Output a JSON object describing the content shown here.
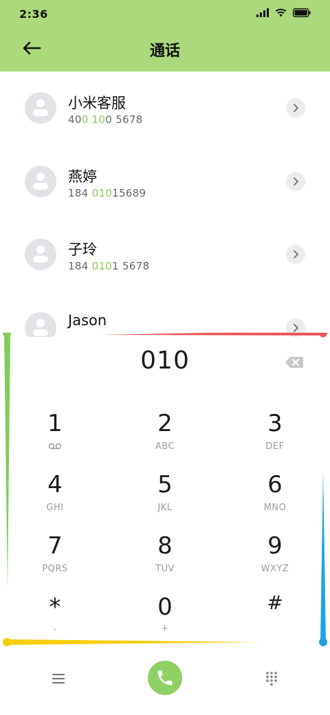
{
  "status_bar": {
    "time": "2:36",
    "icons": [
      "signal-icon",
      "wifi-icon",
      "battery-icon"
    ]
  },
  "header": {
    "title": "通话",
    "back_icon": "arrow-left-icon",
    "background_color": "#abd97c"
  },
  "contacts": [
    {
      "name": "小米客服",
      "number_parts": [
        {
          "text": "40",
          "match": false
        },
        {
          "text": "0",
          "match": true
        },
        {
          "text": " ",
          "match": false
        },
        {
          "text": "10",
          "match": true
        },
        {
          "text": "0 5678",
          "match": false
        }
      ]
    },
    {
      "name": "燕婷",
      "number_parts": [
        {
          "text": "184 ",
          "match": false
        },
        {
          "text": "010",
          "match": true
        },
        {
          "text": "15689",
          "match": false
        }
      ]
    },
    {
      "name": "子玲",
      "number_parts": [
        {
          "text": "184 ",
          "match": false
        },
        {
          "text": "010",
          "match": true
        },
        {
          "text": "1 5678",
          "match": false
        }
      ]
    },
    {
      "name": "Jason",
      "number_parts": []
    }
  ],
  "dialpad": {
    "input_value": "010",
    "delete_icon": "backspace-icon",
    "keys": [
      {
        "digit": "1",
        "letters": "",
        "sub_icon": "voicemail-icon"
      },
      {
        "digit": "2",
        "letters": "ABC"
      },
      {
        "digit": "3",
        "letters": "DEF"
      },
      {
        "digit": "4",
        "letters": "GHI"
      },
      {
        "digit": "5",
        "letters": "JKL"
      },
      {
        "digit": "6",
        "letters": "MNO"
      },
      {
        "digit": "7",
        "letters": "PQRS"
      },
      {
        "digit": "8",
        "letters": "TUV"
      },
      {
        "digit": "9",
        "letters": "WXYZ"
      },
      {
        "digit": "*",
        "letters": ","
      },
      {
        "digit": "0",
        "letters": "+"
      },
      {
        "digit": "#",
        "letters": ""
      }
    ]
  },
  "bottom_bar": {
    "menu_icon": "menu-icon",
    "call_icon": "phone-icon",
    "keypad_icon": "dialpad-icon",
    "call_color": "#8fd064"
  },
  "decoration_colors": {
    "red": "#ea5457",
    "green": "#7fcc5a",
    "blue": "#1fa3e6",
    "yellow": "#f6cd0c",
    "accent_match": "#8dca57"
  }
}
